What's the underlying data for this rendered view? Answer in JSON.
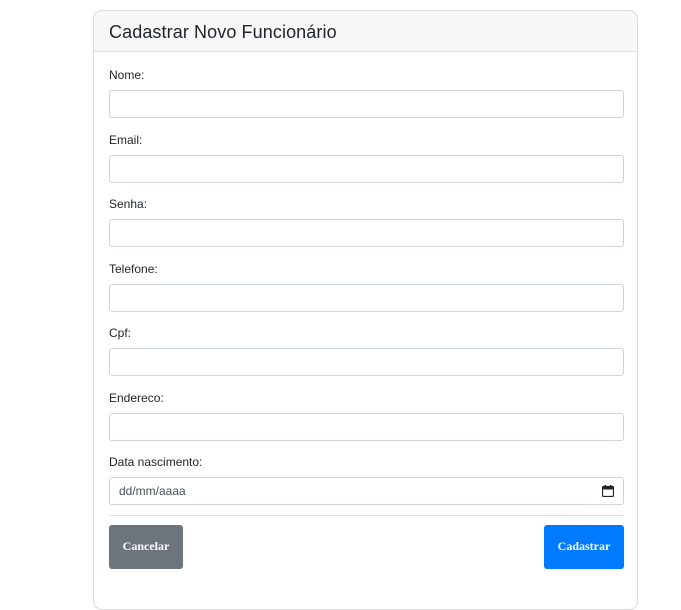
{
  "form": {
    "title": "Cadastrar Novo Funcionário",
    "fields": [
      {
        "label": "Nome:",
        "value": ""
      },
      {
        "label": "Email:",
        "value": ""
      },
      {
        "label": "Senha:",
        "value": ""
      },
      {
        "label": "Telefone:",
        "value": ""
      },
      {
        "label": "Cpf:",
        "value": ""
      },
      {
        "label": "Endereco:",
        "value": ""
      },
      {
        "label": "Data nascimento:",
        "value": "dd/mm/aaaa"
      }
    ],
    "cancel_label": "Cancelar",
    "submit_label": "Cadastrar"
  },
  "colors": {
    "primary": "#007bff",
    "secondary": "#6c757d",
    "header_bg": "#f7f7f7",
    "border": "#ced4da"
  },
  "icons": {
    "date_picker": "calendar-icon"
  }
}
